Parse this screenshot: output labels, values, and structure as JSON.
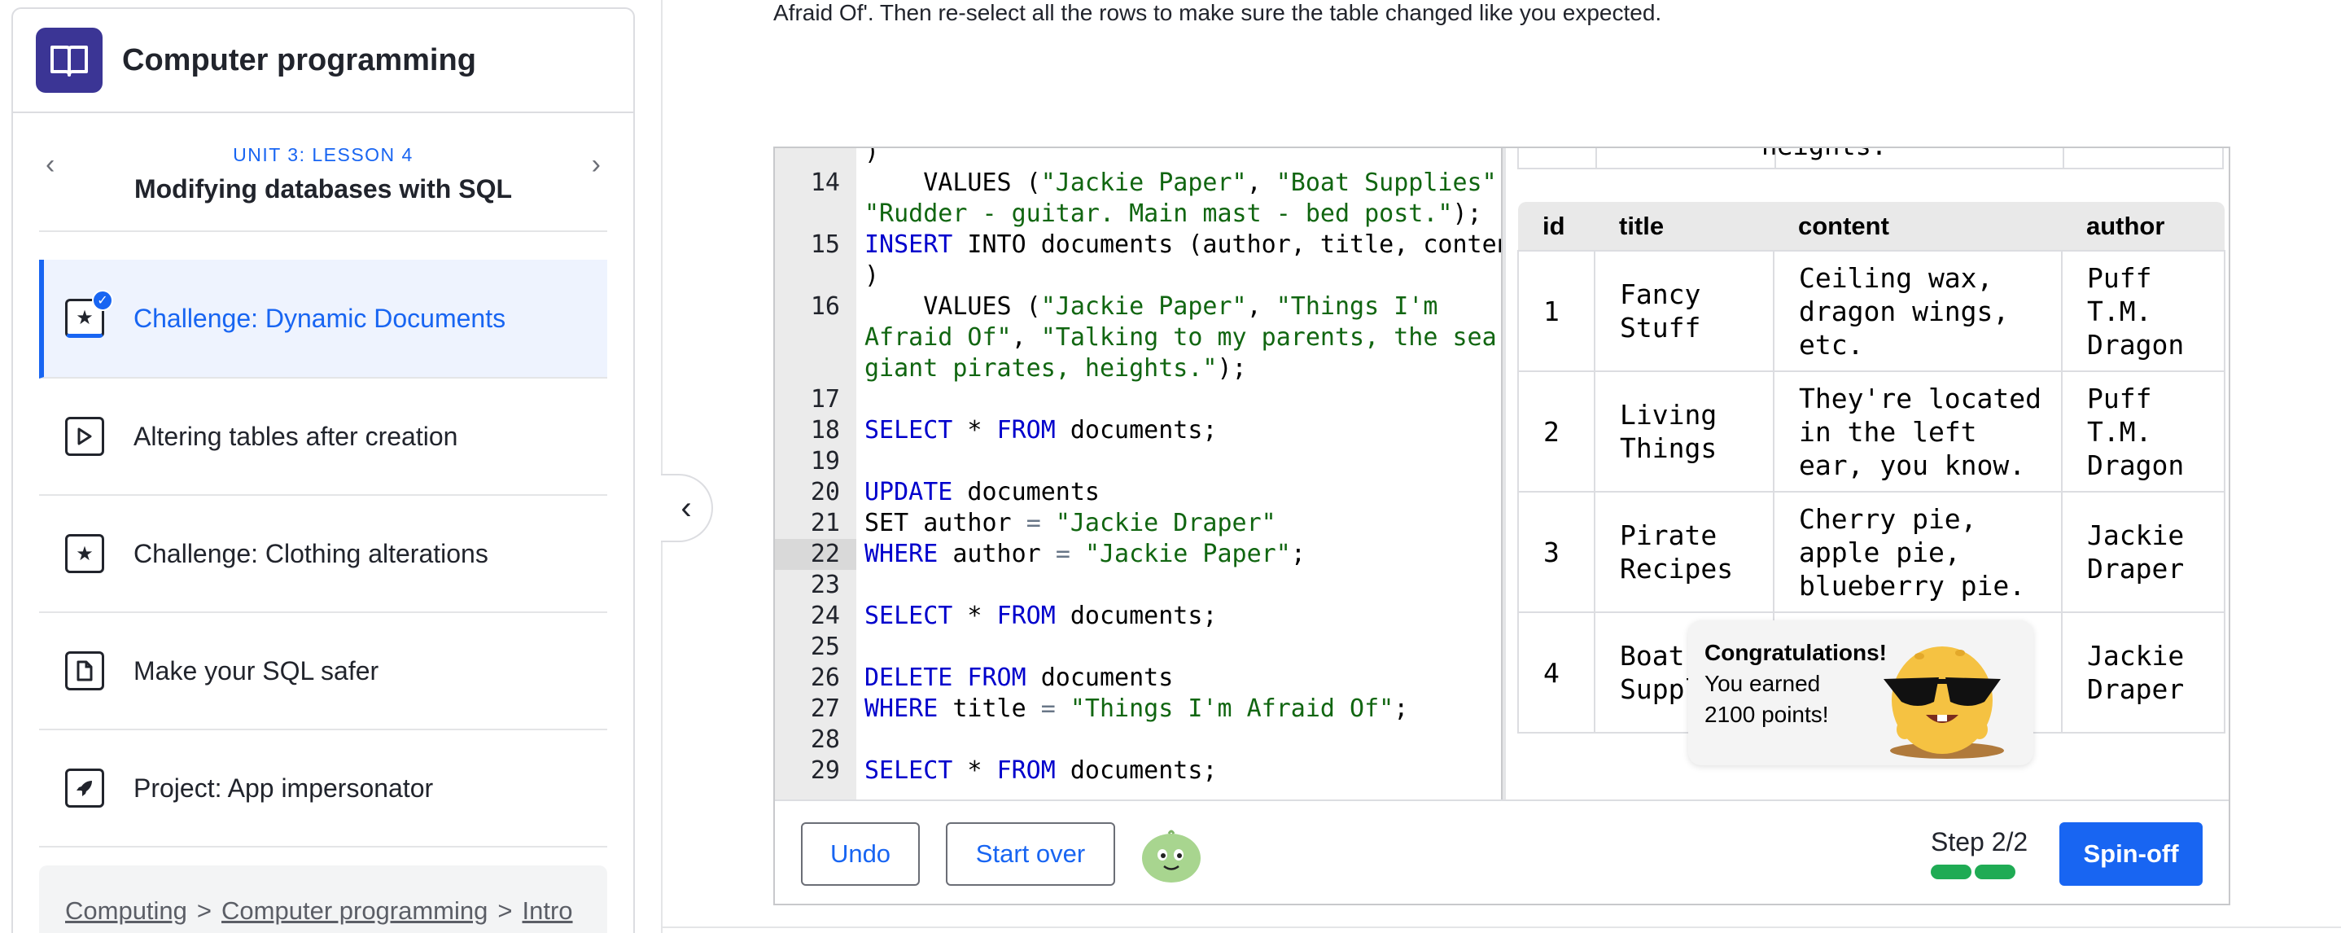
{
  "course": {
    "title": "Computer programming",
    "logo_icon": "book-icon"
  },
  "lesson_nav": {
    "unit": "UNIT 3: LESSON 4",
    "title": "Modifying databases with SQL"
  },
  "lesson_items": [
    {
      "label": "Challenge: Dynamic Documents",
      "icon": "star-icon",
      "active": true,
      "completed": true
    },
    {
      "label": "Altering tables after creation",
      "icon": "play-icon"
    },
    {
      "label": "Challenge: Clothing alterations",
      "icon": "star-icon"
    },
    {
      "label": "Make your SQL safer",
      "icon": "article-icon"
    },
    {
      "label": "Project: App impersonator",
      "icon": "rocket-icon"
    }
  ],
  "breadcrumb": {
    "items": [
      "Computing",
      "Computer programming",
      "Intro"
    ],
    "separator": ">"
  },
  "instructions": {
    "text": "Afraid Of'. Then re-select all the rows to make sure the table changed like you expected."
  },
  "code": {
    "current_line": 22,
    "lines": [
      {
        "num": "",
        "tokens": [
          {
            "t": ")",
            "c": "plain"
          }
        ]
      },
      {
        "num": "14",
        "tokens": [
          {
            "t": "    VALUES (",
            "c": "plain"
          },
          {
            "t": "\"Jackie Paper\"",
            "c": "str"
          },
          {
            "t": ", ",
            "c": "plain"
          },
          {
            "t": "\"Boat Supplies\"",
            "c": "str"
          },
          {
            "t": ",",
            "c": "plain"
          }
        ]
      },
      {
        "num": "",
        "tokens": [
          {
            "t": "\"Rudder - guitar. Main mast - bed post.\"",
            "c": "str"
          },
          {
            "t": ");",
            "c": "plain"
          }
        ]
      },
      {
        "num": "15",
        "tokens": [
          {
            "t": "INSERT",
            "c": "kw"
          },
          {
            "t": " INTO documents (author, title, content",
            "c": "plain"
          }
        ]
      },
      {
        "num": "",
        "tokens": [
          {
            "t": ")",
            "c": "plain"
          }
        ]
      },
      {
        "num": "16",
        "tokens": [
          {
            "t": "    VALUES (",
            "c": "plain"
          },
          {
            "t": "\"Jackie Paper\"",
            "c": "str"
          },
          {
            "t": ", ",
            "c": "plain"
          },
          {
            "t": "\"Things I'm",
            "c": "str"
          }
        ]
      },
      {
        "num": "",
        "tokens": [
          {
            "t": "Afraid Of\"",
            "c": "str"
          },
          {
            "t": ", ",
            "c": "plain"
          },
          {
            "t": "\"Talking to my parents, the sea,",
            "c": "str"
          }
        ]
      },
      {
        "num": "",
        "tokens": [
          {
            "t": "giant pirates, heights.\"",
            "c": "str"
          },
          {
            "t": ");",
            "c": "plain"
          }
        ]
      },
      {
        "num": "17",
        "tokens": []
      },
      {
        "num": "18",
        "tokens": [
          {
            "t": "SELECT",
            "c": "kw"
          },
          {
            "t": " * ",
            "c": "plain"
          },
          {
            "t": "FROM",
            "c": "kw"
          },
          {
            "t": " documents;",
            "c": "plain"
          }
        ]
      },
      {
        "num": "19",
        "tokens": []
      },
      {
        "num": "20",
        "tokens": [
          {
            "t": "UPDATE",
            "c": "kw"
          },
          {
            "t": " documents",
            "c": "plain"
          }
        ]
      },
      {
        "num": "21",
        "tokens": [
          {
            "t": "SET author ",
            "c": "plain"
          },
          {
            "t": "=",
            "c": "op"
          },
          {
            "t": " ",
            "c": "plain"
          },
          {
            "t": "\"Jackie Draper\"",
            "c": "str"
          }
        ]
      },
      {
        "num": "22",
        "tokens": [
          {
            "t": "WHERE",
            "c": "kw"
          },
          {
            "t": " author ",
            "c": "plain"
          },
          {
            "t": "=",
            "c": "op"
          },
          {
            "t": " ",
            "c": "plain"
          },
          {
            "t": "\"Jackie Paper\"",
            "c": "str"
          },
          {
            "t": ";",
            "c": "plain"
          }
        ]
      },
      {
        "num": "23",
        "tokens": []
      },
      {
        "num": "24",
        "tokens": [
          {
            "t": "SELECT",
            "c": "kw"
          },
          {
            "t": " * ",
            "c": "plain"
          },
          {
            "t": "FROM",
            "c": "kw"
          },
          {
            "t": " documents;",
            "c": "plain"
          }
        ]
      },
      {
        "num": "25",
        "tokens": []
      },
      {
        "num": "26",
        "tokens": [
          {
            "t": "DELETE FROM",
            "c": "kw"
          },
          {
            "t": " documents",
            "c": "plain"
          }
        ]
      },
      {
        "num": "27",
        "tokens": [
          {
            "t": "WHERE",
            "c": "kw"
          },
          {
            "t": " title ",
            "c": "plain"
          },
          {
            "t": "=",
            "c": "op"
          },
          {
            "t": " ",
            "c": "plain"
          },
          {
            "t": "\"Things I'm Afraid Of\"",
            "c": "str"
          },
          {
            "t": ";",
            "c": "plain"
          }
        ]
      },
      {
        "num": "28",
        "tokens": []
      },
      {
        "num": "29",
        "tokens": [
          {
            "t": "SELECT",
            "c": "kw"
          },
          {
            "t": " * ",
            "c": "plain"
          },
          {
            "t": "FROM",
            "c": "kw"
          },
          {
            "t": " documents;",
            "c": "plain"
          }
        ]
      }
    ]
  },
  "results": {
    "previous_table_cut_text": "heights.",
    "columns": [
      "id",
      "title",
      "content",
      "author"
    ],
    "rows": [
      {
        "id": "1",
        "title": "Fancy\nStuff",
        "content": "Ceiling wax,\ndragon wings,\netc.",
        "author": "Puff\nT.M.\nDragon"
      },
      {
        "id": "2",
        "title": "Living\nThings",
        "content": "They're located\nin the left\near, you know.",
        "author": "Puff\nT.M.\nDragon"
      },
      {
        "id": "3",
        "title": "Pirate\nRecipes",
        "content": "Cherry pie,\napple pie,\nblueberry pie.",
        "author": "Jackie\nDraper"
      },
      {
        "id": "4",
        "title": "Boat\nSuppl",
        "content": "",
        "author": "Jackie\nDraper"
      }
    ]
  },
  "toast": {
    "title": "Congratulations!",
    "line1": "You earned",
    "line2": "2100 points!"
  },
  "toolbar": {
    "undo_label": "Undo",
    "start_over_label": "Start over",
    "step_label": "Step 2/2",
    "steps_total": 2,
    "steps_done": 2,
    "spinoff_label": "Spin-off"
  },
  "colors": {
    "accent": "#1865f2",
    "keyword": "#0000cc",
    "string": "#116611",
    "progress": "#1fab54"
  }
}
